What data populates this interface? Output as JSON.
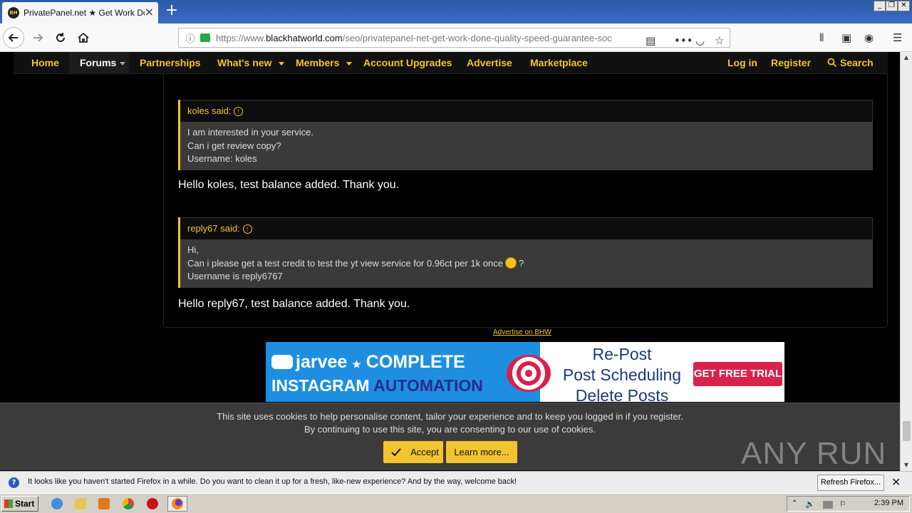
{
  "browser": {
    "tab_title": "PrivatePanel.net ★ Get Work Done",
    "tab_favicon_text": "BH",
    "url_prefix": "https://www.",
    "url_domain": "blackhatworld.com",
    "url_path": "/seo/privatepanel-net-get-work-done-quality-speed-guarantee-soc"
  },
  "forum_nav": {
    "home": "Home",
    "forums": "Forums",
    "partnerships": "Partnerships",
    "whats_new": "What's new",
    "members": "Members",
    "account_upgrades": "Account Upgrades",
    "advertise": "Advertise",
    "marketplace": "Marketplace",
    "login": "Log in",
    "register": "Register",
    "search": "Search"
  },
  "posts": [
    {
      "quote_author": "koles said:",
      "quote_lines": [
        "I am interested in your service.",
        "Can i get review copy?",
        "Username: koles"
      ],
      "reply": "Hello koles, test balance added. Thank you."
    },
    {
      "quote_author": "reply67 said:",
      "quote_lines": [
        "Hi,",
        "Can i please get a test credit to test the yt view service for 0.96ct per 1k once",
        "?",
        "Username is reply6767"
      ],
      "reply": "Hello reply67, test balance added. Thank you."
    }
  ],
  "advertise_link": "Advertise on BHW",
  "banner": {
    "brand": "jarvee",
    "line1": "COMPLETE",
    "line2a": "INSTAGRAM",
    "line2b": "AUTOMATION",
    "right1": "Re-Post",
    "right2": "Post Scheduling",
    "right3": "Delete Posts",
    "cta": "GET FREE TRIAL"
  },
  "cookie": {
    "line1": "This site uses cookies to help personalise content, tailor your experience and to keep you logged in if you register.",
    "line2": "By continuing to use this site, you are consenting to our use of cookies.",
    "accept": "Accept",
    "learn_more": "Learn more..."
  },
  "watermark": "ANY RUN",
  "notification": {
    "text": "It looks like you haven't started Firefox in a while. Do you want to clean it up for a fresh, like-new experience? And by the way, welcome back!",
    "button": "Refresh Firefox..."
  },
  "taskbar": {
    "start": "Start",
    "clock": "2:39 PM"
  },
  "colors": {
    "accent": "#f4c430",
    "background": "#000000",
    "quote_bg": "#3a3a3a"
  }
}
